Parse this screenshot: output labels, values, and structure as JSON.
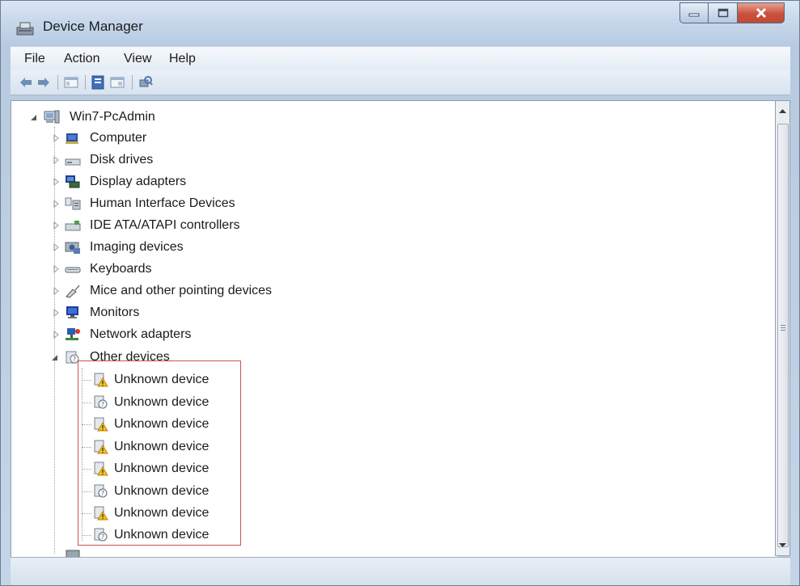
{
  "window": {
    "title": "Device Manager"
  },
  "menu": [
    {
      "label": "File"
    },
    {
      "label": "Action"
    },
    {
      "label": "View"
    },
    {
      "label": "Help"
    }
  ],
  "tree": {
    "root": {
      "label": "Win7-PcAdmin",
      "icon": "computer-root-icon",
      "expanded": true
    },
    "categories": [
      {
        "label": "Computer",
        "icon": "computer-icon"
      },
      {
        "label": "Disk drives",
        "icon": "disk-drive-icon"
      },
      {
        "label": "Display adapters",
        "icon": "display-adapter-icon"
      },
      {
        "label": "Human Interface Devices",
        "icon": "hid-icon"
      },
      {
        "label": "IDE ATA/ATAPI controllers",
        "icon": "ide-controller-icon"
      },
      {
        "label": "Imaging devices",
        "icon": "camera-icon"
      },
      {
        "label": "Keyboards",
        "icon": "keyboard-icon"
      },
      {
        "label": "Mice and other pointing devices",
        "icon": "mouse-icon"
      },
      {
        "label": "Monitors",
        "icon": "monitor-icon"
      },
      {
        "label": "Network adapters",
        "icon": "network-icon"
      },
      {
        "label": "Other devices",
        "icon": "unknown-device-icon",
        "expanded": true
      }
    ],
    "other_devices": [
      {
        "label": "Unknown device",
        "icon": "warning-device-icon"
      },
      {
        "label": "Unknown device",
        "icon": "question-device-icon"
      },
      {
        "label": "Unknown device",
        "icon": "warning-device-icon"
      },
      {
        "label": "Unknown device",
        "icon": "warning-device-icon"
      },
      {
        "label": "Unknown device",
        "icon": "warning-device-icon"
      },
      {
        "label": "Unknown device",
        "icon": "question-device-icon"
      },
      {
        "label": "Unknown device",
        "icon": "warning-device-icon"
      },
      {
        "label": "Unknown device",
        "icon": "question-device-icon"
      }
    ]
  },
  "colors": {
    "highlight_box": "#d05050",
    "title_bar": "#c6d7ea",
    "close_button": "#c9513b"
  }
}
